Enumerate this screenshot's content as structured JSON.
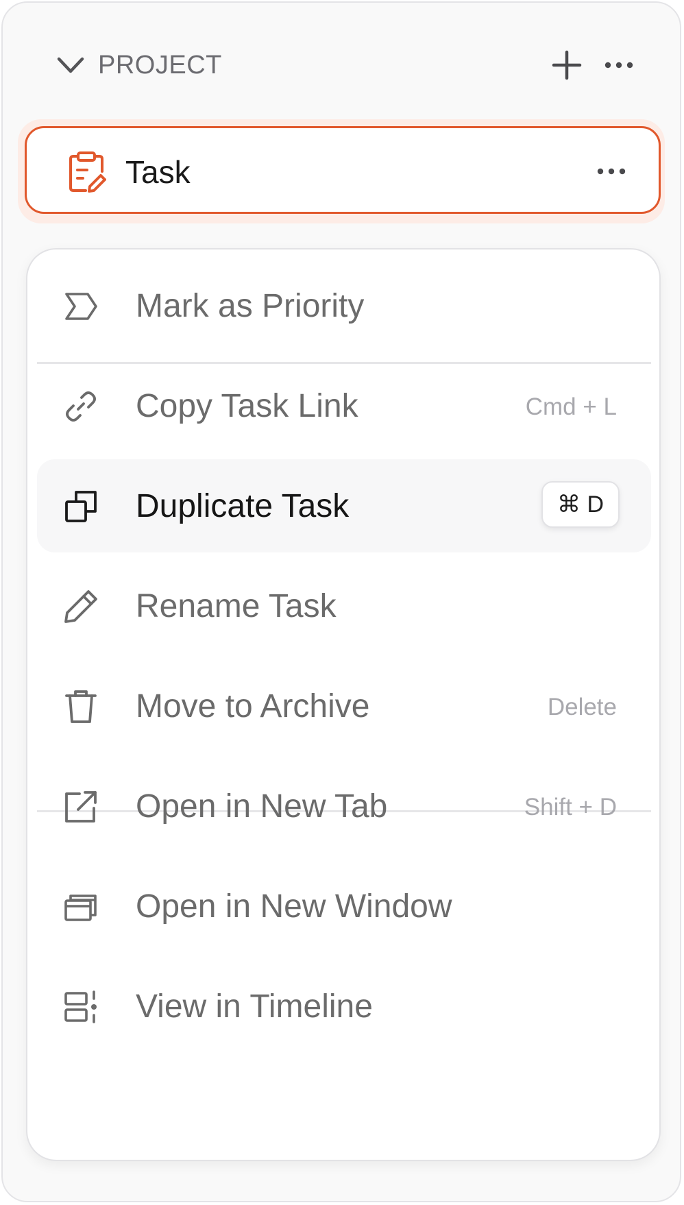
{
  "header": {
    "title": "PROJECT",
    "icons": [
      "chevron-down-icon",
      "plus-icon",
      "more-horizontal-icon"
    ]
  },
  "task": {
    "label": "Task",
    "icon": "clipboard-edit-icon",
    "accent_color": "#e1582c"
  },
  "menu": {
    "items": [
      {
        "label": "Mark as Priority",
        "icon": "priority-tag-icon",
        "shortcut": ""
      },
      {
        "label": "Copy Task Link",
        "icon": "link-icon",
        "shortcut": "Cmd + L"
      },
      {
        "label": "Duplicate Task",
        "icon": "duplicate-icon",
        "shortcut": "⌘ D",
        "highlighted": true
      },
      {
        "label": "Rename Task",
        "icon": "pencil-icon",
        "shortcut": ""
      },
      {
        "label": "Move to Archive",
        "icon": "trash-icon",
        "shortcut": "Delete"
      },
      {
        "label": "Open in New Tab",
        "icon": "external-link-icon",
        "shortcut": "Shift + D"
      },
      {
        "label": "Open in New Window",
        "icon": "windows-icon",
        "shortcut": ""
      },
      {
        "label": "View in Timeline",
        "icon": "timeline-icon",
        "shortcut": ""
      }
    ]
  },
  "colors": {
    "panel_bg": "#f9f9f9",
    "menu_bg": "#ffffff",
    "text_muted": "#6b6b6b",
    "text_strong": "#161616",
    "shortcut_text": "#a8a8ad"
  }
}
